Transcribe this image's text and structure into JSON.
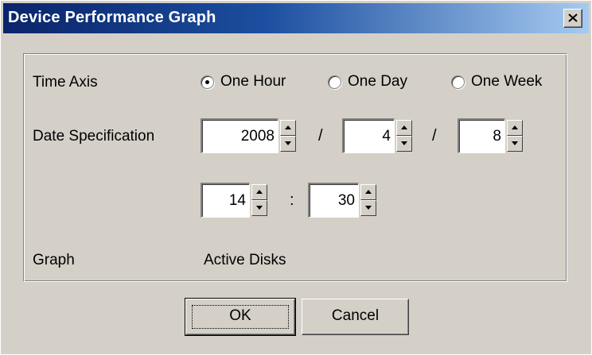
{
  "window": {
    "title": "Device Performance Graph"
  },
  "time_axis": {
    "label": "Time Axis",
    "options": [
      {
        "label": "One Hour",
        "selected": true
      },
      {
        "label": "One Day",
        "selected": false
      },
      {
        "label": "One Week",
        "selected": false
      }
    ]
  },
  "date_spec": {
    "label": "Date Specification",
    "year": "2008",
    "month": "4",
    "day": "8",
    "date_separator": "/",
    "hour": "14",
    "minute": "30",
    "time_separator": ":"
  },
  "graph": {
    "label": "Graph",
    "value": "Active Disks"
  },
  "buttons": {
    "ok": "OK",
    "cancel": "Cancel"
  },
  "icons": {
    "close": "close-icon",
    "spin_up": "arrow-up-icon",
    "spin_down": "arrow-down-icon"
  }
}
